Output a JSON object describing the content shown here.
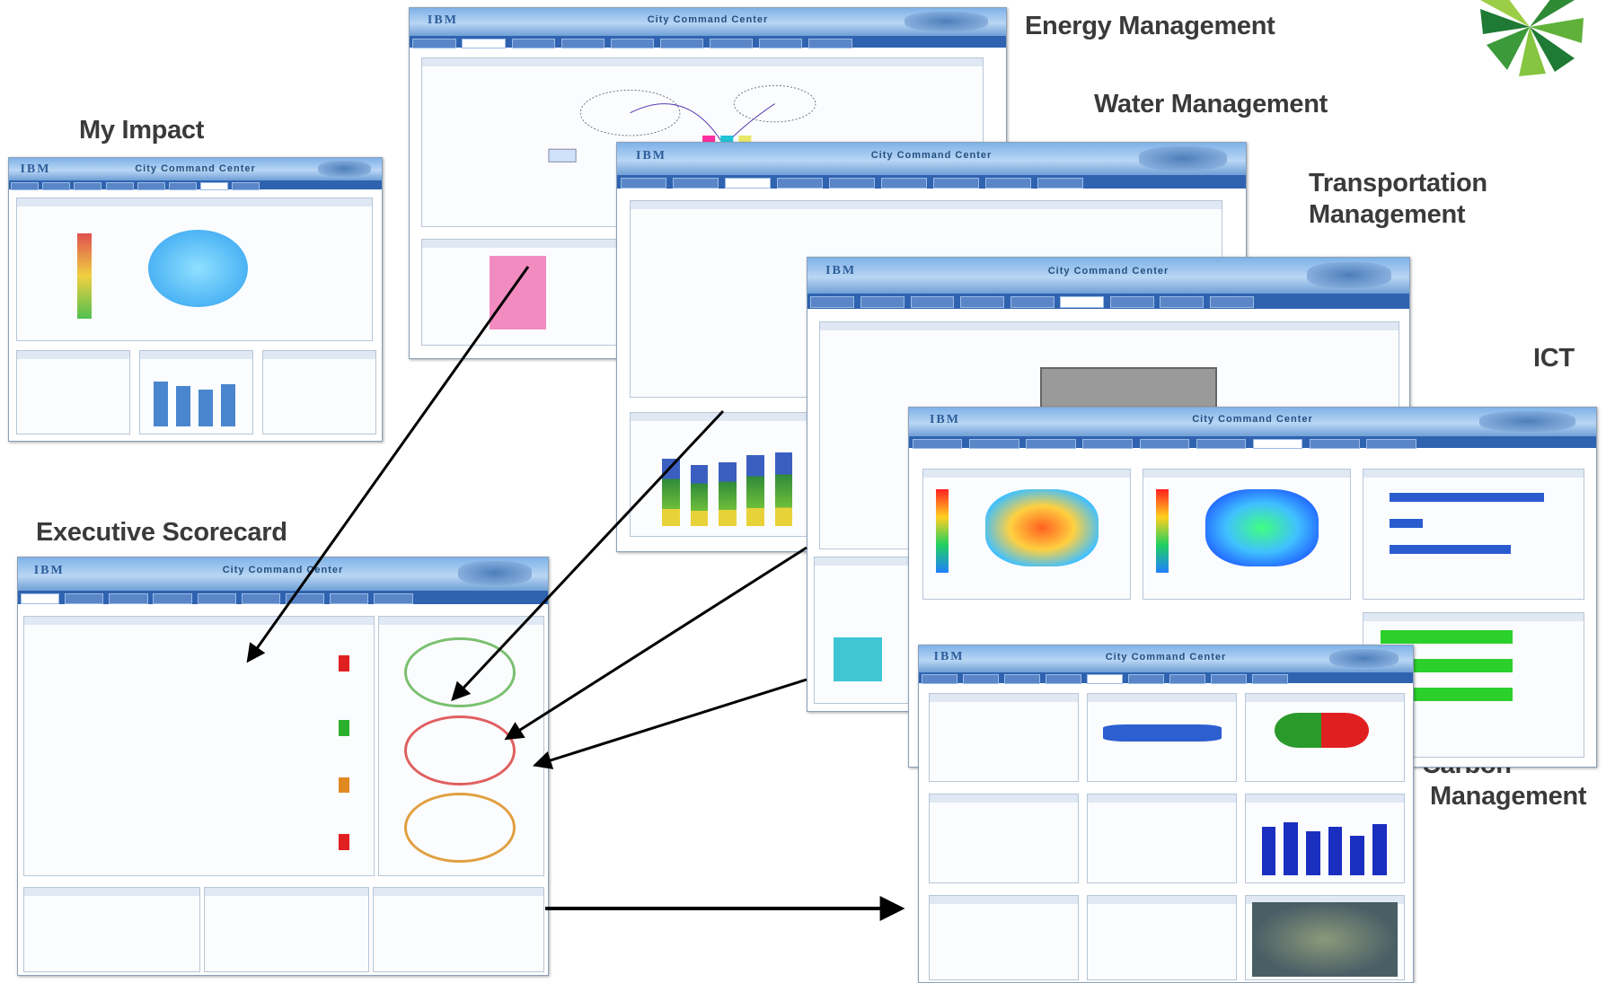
{
  "labels": {
    "energy": "Energy Management",
    "water": "Water Management",
    "transportation": [
      "Transportation",
      "Management"
    ],
    "ict": "ICT",
    "my_impact": "My Impact",
    "executive": "Executive Scorecard",
    "carbon": [
      "Carbon",
      "Management"
    ]
  },
  "screens": {
    "header_title": "City Command Center",
    "logo_text": "IBM"
  },
  "colors": {
    "header_blue": "#7fb2e8",
    "nav_blue": "#2f63b0",
    "label_text": "#3a3a3a",
    "logo_green_dark": "#1e7a34",
    "logo_green_light": "#86c540"
  }
}
